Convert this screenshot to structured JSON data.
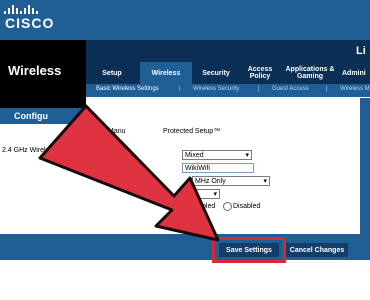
{
  "brand": {
    "logo_text": "CISCO",
    "right_partial": "Li"
  },
  "section_title": "Wireless",
  "tabs": [
    {
      "label": "Setup",
      "active": false
    },
    {
      "label": "Wireless",
      "active": true
    },
    {
      "label": "Security",
      "active": false
    },
    {
      "label": "Access Policy",
      "active": false
    },
    {
      "label": "Applications & Gaming",
      "active": false
    },
    {
      "label": "Admini",
      "active": false
    }
  ],
  "subtabs": [
    {
      "label": "Basic Wireless Settings",
      "active": true
    },
    {
      "label": "Wireless Security",
      "active": false
    },
    {
      "label": "Guest Access",
      "active": false
    },
    {
      "label": "Wireless M",
      "active": false
    }
  ],
  "left_panel": {
    "config_label": "Configu",
    "setting_label": "2.4 GHz Wireless Settin"
  },
  "content": {
    "manual_partial": "Manu",
    "wps_partial": "Protected Setup™",
    "mode_value": "Mixed",
    "ssid_value": "WikiWifi",
    "channel_width_value": "MHz Only",
    "ssid_broadcast_enabled_partial": "bled",
    "ssid_broadcast_disabled": "Disabled"
  },
  "footer": {
    "save_label": "Save Settings",
    "cancel_label": "Cancel Changes"
  },
  "colors": {
    "brand_blue": "#1f5f96",
    "dark_navy": "#0b2f55",
    "highlight_red": "#d8263a",
    "arrow_red": "#e03342"
  }
}
